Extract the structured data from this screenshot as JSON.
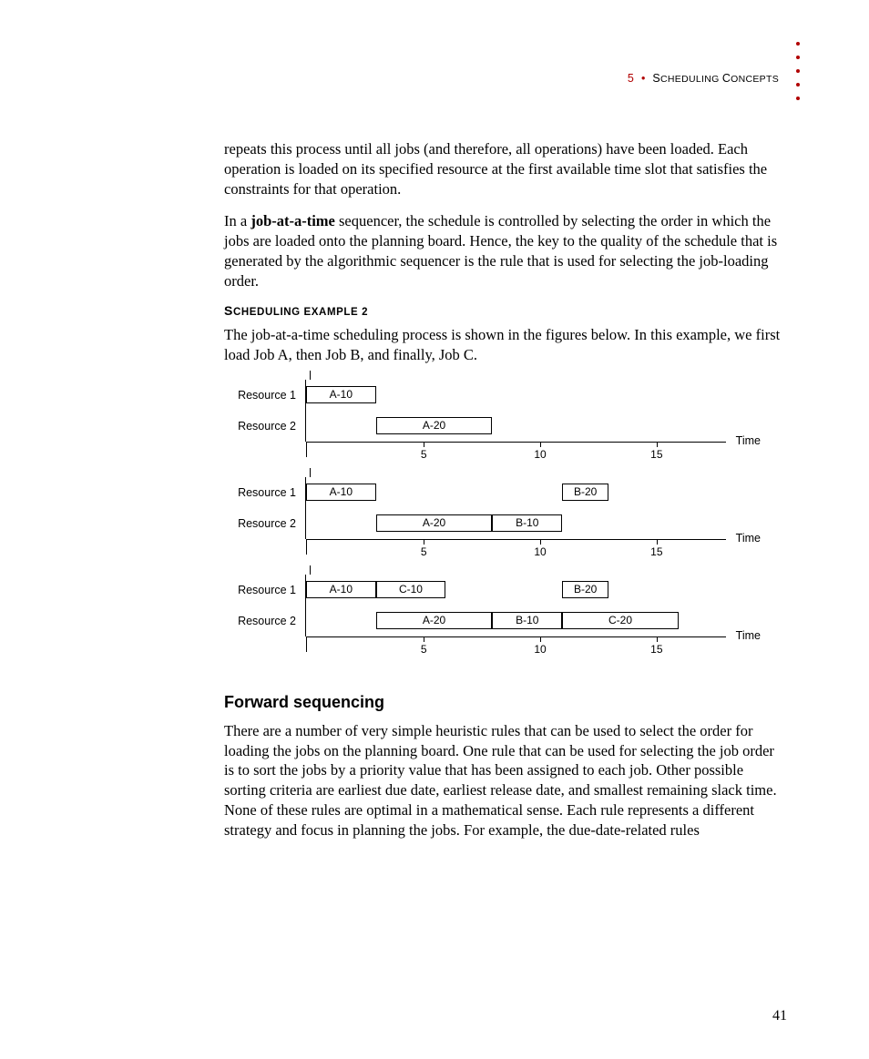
{
  "header": {
    "chapter_num": "5",
    "separator": "•",
    "chapter_title_first": "S",
    "chapter_title_rest": "CHEDULING ",
    "chapter_title_first2": "C",
    "chapter_title_rest2": "ONCEPTS"
  },
  "para1": "repeats this process until all jobs (and therefore, all operations) have been loaded. Each operation is loaded on its specified resource at the first available time slot that satisfies the constraints for that operation.",
  "para2_pre": "In a ",
  "para2_bold": "job-at-a-time",
  "para2_post": " sequencer, the schedule is controlled by selecting the order in which the jobs are loaded onto the planning board. Hence, the key to the quality of the schedule that is generated by the algorithmic sequencer is the rule that is used for selecting the job-loading order.",
  "subhead_first": "S",
  "subhead_rest": "CHEDULING EXAMPLE 2",
  "para3": "The job-at-a-time scheduling process is shown in the figures below. In this example, we first load Job A, then Job B, and finally, Job C.",
  "chart_data": [
    {
      "type": "gantt",
      "xlabel": "Time",
      "ticks": [
        5,
        10,
        15
      ],
      "xmax": 18,
      "rows": [
        {
          "label": "Resource 1",
          "bars": [
            {
              "name": "A-10",
              "start": 0,
              "end": 3
            }
          ]
        },
        {
          "label": "Resource 2",
          "bars": [
            {
              "name": "A-20",
              "start": 3,
              "end": 8
            }
          ]
        }
      ]
    },
    {
      "type": "gantt",
      "xlabel": "Time",
      "ticks": [
        5,
        10,
        15
      ],
      "xmax": 18,
      "rows": [
        {
          "label": "Resource 1",
          "bars": [
            {
              "name": "A-10",
              "start": 0,
              "end": 3
            },
            {
              "name": "B-20",
              "start": 11,
              "end": 13
            }
          ]
        },
        {
          "label": "Resource 2",
          "bars": [
            {
              "name": "A-20",
              "start": 3,
              "end": 8
            },
            {
              "name": "B-10",
              "start": 8,
              "end": 11
            }
          ]
        }
      ]
    },
    {
      "type": "gantt",
      "xlabel": "Time",
      "ticks": [
        5,
        10,
        15
      ],
      "xmax": 18,
      "rows": [
        {
          "label": "Resource 1",
          "bars": [
            {
              "name": "A-10",
              "start": 0,
              "end": 3
            },
            {
              "name": "C-10",
              "start": 3,
              "end": 6
            },
            {
              "name": "B-20",
              "start": 11,
              "end": 13
            }
          ]
        },
        {
          "label": "Resource 2",
          "bars": [
            {
              "name": "A-20",
              "start": 3,
              "end": 8
            },
            {
              "name": "B-10",
              "start": 8,
              "end": 11
            },
            {
              "name": "C-20",
              "start": 11,
              "end": 16
            }
          ]
        }
      ]
    }
  ],
  "section_heading": "Forward sequencing",
  "para4": "There are a number of very simple heuristic rules that can be used to select the order for loading the jobs on the planning board. One rule that can be used for selecting the job order is to sort the jobs by a priority value that has been assigned to each job. Other possible sorting criteria are earliest due date, earliest release date, and smallest remaining slack time. None of these rules are optimal in a mathematical sense. Each rule represents a different strategy and focus in planning the jobs. For example, the due-date-related rules",
  "page_number": "41"
}
